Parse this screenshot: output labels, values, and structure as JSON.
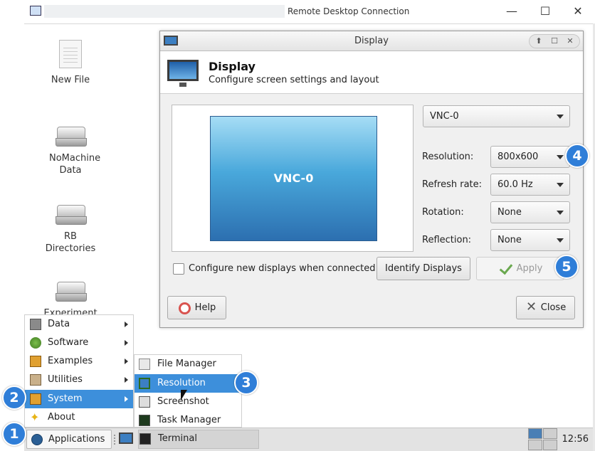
{
  "window": {
    "title": "Remote Desktop Connection",
    "minimize": "—",
    "maximize": "☐",
    "close": "✕"
  },
  "desktop": {
    "icons": [
      {
        "label": "New File"
      },
      {
        "label": "NoMachine Data"
      },
      {
        "label": "RB Directories"
      },
      {
        "label": "Experiment"
      }
    ]
  },
  "dialog": {
    "title": "Display",
    "header_title": "Display",
    "header_subtitle": "Configure screen settings and layout",
    "preview_label": "VNC-0",
    "output_select": "VNC-0",
    "resolution_label": "Resolution:",
    "resolution_value": "800x600",
    "refresh_label": "Refresh rate:",
    "refresh_value": "60.0 Hz",
    "rotation_label": "Rotation:",
    "rotation_value": "None",
    "reflection_label": "Reflection:",
    "reflection_value": "None",
    "configure_new_label": "Configure new displays when connected",
    "identify_label": "Identify Displays",
    "apply_label": "Apply",
    "help_label": "Help",
    "close_label": "Close",
    "title_controls": {
      "up": "⬆",
      "max": "☐",
      "close": "✕"
    }
  },
  "menu": {
    "items": [
      {
        "label": "Data"
      },
      {
        "label": "Software"
      },
      {
        "label": "Examples"
      },
      {
        "label": "Utilities"
      },
      {
        "label": "System"
      },
      {
        "label": "About"
      }
    ]
  },
  "submenu": {
    "items": [
      {
        "label": "File Manager"
      },
      {
        "label": "Resolution"
      },
      {
        "label": "Screenshot"
      },
      {
        "label": "Task Manager"
      },
      {
        "label": "Terminal"
      }
    ]
  },
  "taskbar": {
    "applications_label": "Applications",
    "clock": "12:56"
  },
  "badges": [
    "1",
    "2",
    "3",
    "4",
    "5"
  ],
  "colors": {
    "accent": "#3d8fdb",
    "badge": "#2f7ed8"
  }
}
